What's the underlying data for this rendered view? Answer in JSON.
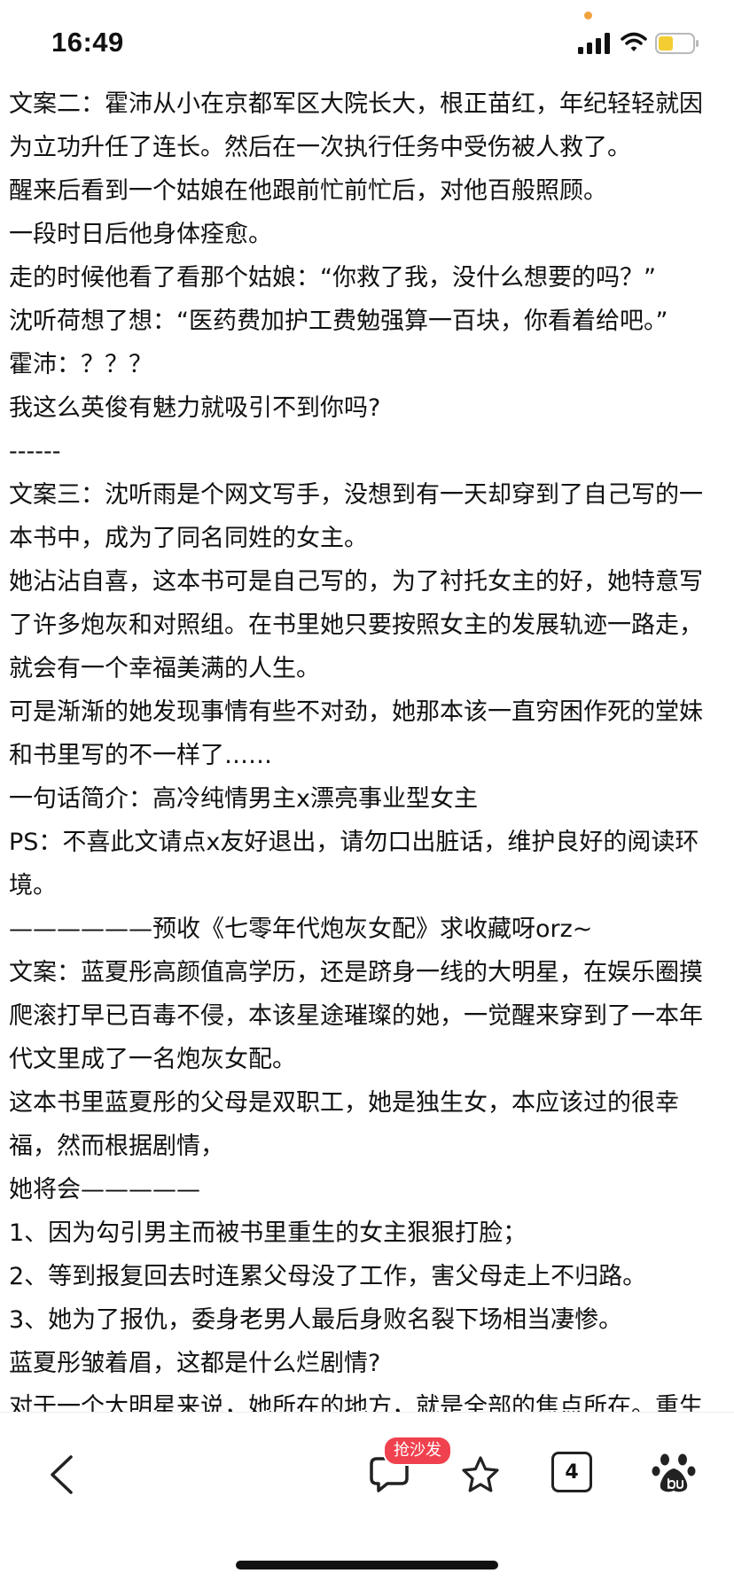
{
  "status_bar": {
    "time": "16:49"
  },
  "article": {
    "lines": [
      "文案二：霍沛从小在京都军区大院长大，根正苗红，年纪轻轻就因",
      "为立功升任了连长。然后在一次执行任务中受伤被人救了。",
      "醒来后看到一个姑娘在他跟前忙前忙后，对他百般照顾。",
      "一段时日后他身体痊愈。",
      "走的时候他看了看那个姑娘：“你救了我，没什么想要的吗？”",
      "沈听荷想了想：“医药费加护工费勉强算一百块，你看着给吧。”",
      "霍沛：？？？",
      "我这么英俊有魅力就吸引不到你吗?",
      "------",
      "文案三：沈听雨是个网文写手，没想到有一天却穿到了自己写的一",
      "本书中，成为了同名同姓的女主。",
      "她沾沾自喜，这本书可是自己写的，为了衬托女主的好，她特意写",
      "了许多炮灰和对照组。在书里她只要按照女主的发展轨迹一路走，",
      "就会有一个幸福美满的人生。",
      "可是渐渐的她发现事情有些不对劲，她那本该一直穷困作死的堂妹",
      "和书里写的不一样了……",
      "一句话简介：高冷纯情男主x漂亮事业型女主",
      "PS：不喜此文请点x友好退出，请勿口出脏话，维护良好的阅读环",
      "境。",
      "——————预收《七零年代炮灰女配》求收藏呀orz~",
      "文案：蓝夏彤高颜值高学历，还是跻身一线的大明星，在娱乐圈摸",
      "爬滚打早已百毒不侵，本该星途璀璨的她，一觉醒来穿到了一本年",
      "代文里成了一名炮灰女配。",
      "这本书里蓝夏彤的父母是双职工，她是独生女，本应该过的很幸",
      "福，然而根据剧情，",
      "她将会—————",
      "1、因为勾引男主而被书里重生的女主狠狠打脸；",
      "2、等到报复回去时连累父母没了工作，害父母走上不归路。",
      "3、她为了报仇，委身老男人最后身败名裂下场相当凄惨。",
      "蓝夏彤皱着眉，这都是什么烂剧情?",
      "对于一个大明星来说，她所在的地方，就是全部的焦点所在。重生"
    ]
  },
  "bottom_bar": {
    "sofa_badge": "抢沙发",
    "tab_count": "4"
  },
  "colors": {
    "badge": "#f0414e",
    "status_dot": "#f0a23c",
    "battery_fill": "#f3cd32"
  }
}
